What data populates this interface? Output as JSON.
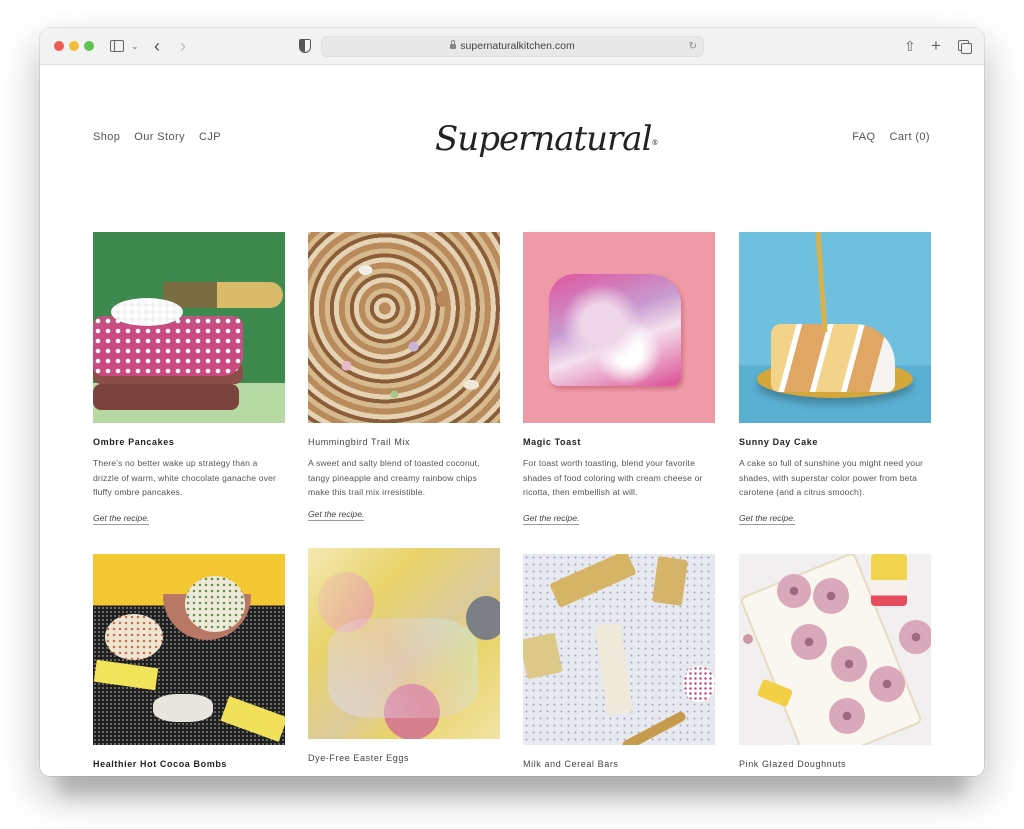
{
  "browser": {
    "url": "supernaturalkitchen.com",
    "icons": {
      "sidebar": "sidebar-icon",
      "chevron": "chevron-down-icon",
      "back": "back-arrow-icon",
      "forward": "forward-arrow-icon",
      "privacy": "shield-icon",
      "lock": "lock-icon",
      "reload": "reload-icon",
      "share": "share-icon",
      "new_tab": "plus-icon",
      "tabs": "tab-overview-icon"
    },
    "glyphs": {
      "chevron": "⌄",
      "back": "‹",
      "forward": "›",
      "reload": "↻",
      "share": "⇧",
      "plus": "+"
    }
  },
  "site": {
    "logo": "Supernatural",
    "logo_mark": "®",
    "nav_left": [
      {
        "label": "Shop"
      },
      {
        "label": "Our Story"
      },
      {
        "label": "CJP"
      }
    ],
    "nav_right": [
      {
        "label": "FAQ"
      },
      {
        "label": "Cart (0)"
      }
    ]
  },
  "recipes": [
    {
      "title": "Ombre Pancakes",
      "description": "There's no better wake up strategy than a drizzle of warm, white chocolate ganache over fluffy ombre pancakes.",
      "link": "Get the recipe.",
      "image": "stacked pink pancakes with sprinkles and gold fork on green background"
    },
    {
      "title": "Hummingbird Trail Mix",
      "description": "A sweet and salty blend of toasted coconut, tangy pineapple and creamy rainbow chips make this trail mix irresistible.",
      "link": "Get the recipe.",
      "image": "trail mix of nuts and colorful chips"
    },
    {
      "title": "Magic Toast",
      "description": "For toast worth toasting, blend your favorite shades of food coloring with cream cheese or ricotta, then embellish at will.",
      "link": "Get the recipe.",
      "image": "pink marbled toast with star sprinkles on pink background"
    },
    {
      "title": "Sunny Day Cake",
      "description": "A cake so full of sunshine you might need your shades, with superstar color power from beta carotene (and a citrus smooch).",
      "link": "Get the recipe.",
      "image": "slice of layered yellow cake on gold plate with fork on blue background"
    },
    {
      "title": "Healthier Hot Cocoa Bombs",
      "image": "hot cocoa bombs with sprinkles on yellow and black background"
    },
    {
      "title": "Dye-Free Easter Eggs",
      "image": "pastel easter eggs in iridescent cellophane"
    },
    {
      "title": "Milk and Cereal Bars",
      "image": "cereal bars with rainbow sprinkles on marble surface"
    },
    {
      "title": "Pink Glazed Doughnuts",
      "image": "pink glazed doughnuts on white tray"
    }
  ],
  "colors": {
    "pancake_bg": "#3e8a4e",
    "toast_bg": "#f09aa8",
    "cake_bg": "#6fc0df",
    "cocoa_bg": "#f4c832",
    "eggs_bg": "#e9d36a",
    "bars_bg": "#e7e9ee",
    "donut_bg": "#f1eff0"
  }
}
